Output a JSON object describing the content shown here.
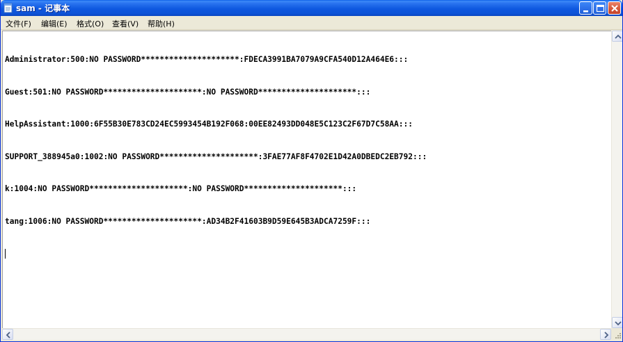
{
  "window": {
    "title": "sam - 记事本",
    "title_icon": "notepad-icon"
  },
  "titlebar_buttons": {
    "minimize_icon": "minimize-icon",
    "maximize_icon": "maximize-icon",
    "close_icon": "close-icon"
  },
  "menu": {
    "items": [
      {
        "label": "文件(F)"
      },
      {
        "label": "编辑(E)"
      },
      {
        "label": "格式(O)"
      },
      {
        "label": "查看(V)"
      },
      {
        "label": "帮助(H)"
      }
    ]
  },
  "document": {
    "lines": [
      "Administrator:500:NO PASSWORD*********************:FDECA3991BA7079A9CFA540D12A464E6:::",
      "Guest:501:NO PASSWORD*********************:NO PASSWORD*********************:::",
      "HelpAssistant:1000:6F55B30E783CD24EC5993454B192F068:00EE82493DD048E5C123C2F67D7C58AA:::",
      "SUPPORT_388945a0:1002:NO PASSWORD*********************:3FAE77AF8F4702E1D42A0DBEDC2EB792:::",
      "k:1004:NO PASSWORD*********************:NO PASSWORD*********************:::",
      "tang:1006:NO PASSWORD*********************:AD34B2F41603B9D59E645B3ADCA7259F:::"
    ]
  },
  "scrollbars": {
    "up_icon": "scroll-up-arrow-icon",
    "down_icon": "scroll-down-arrow-icon",
    "left_icon": "scroll-left-arrow-icon",
    "right_icon": "scroll-right-arrow-icon",
    "grip_icon": "resize-grip-icon"
  },
  "colors": {
    "titlebar": "#0D52D6",
    "close_button": "#D85D3E",
    "chrome": "#ECE9D8"
  }
}
